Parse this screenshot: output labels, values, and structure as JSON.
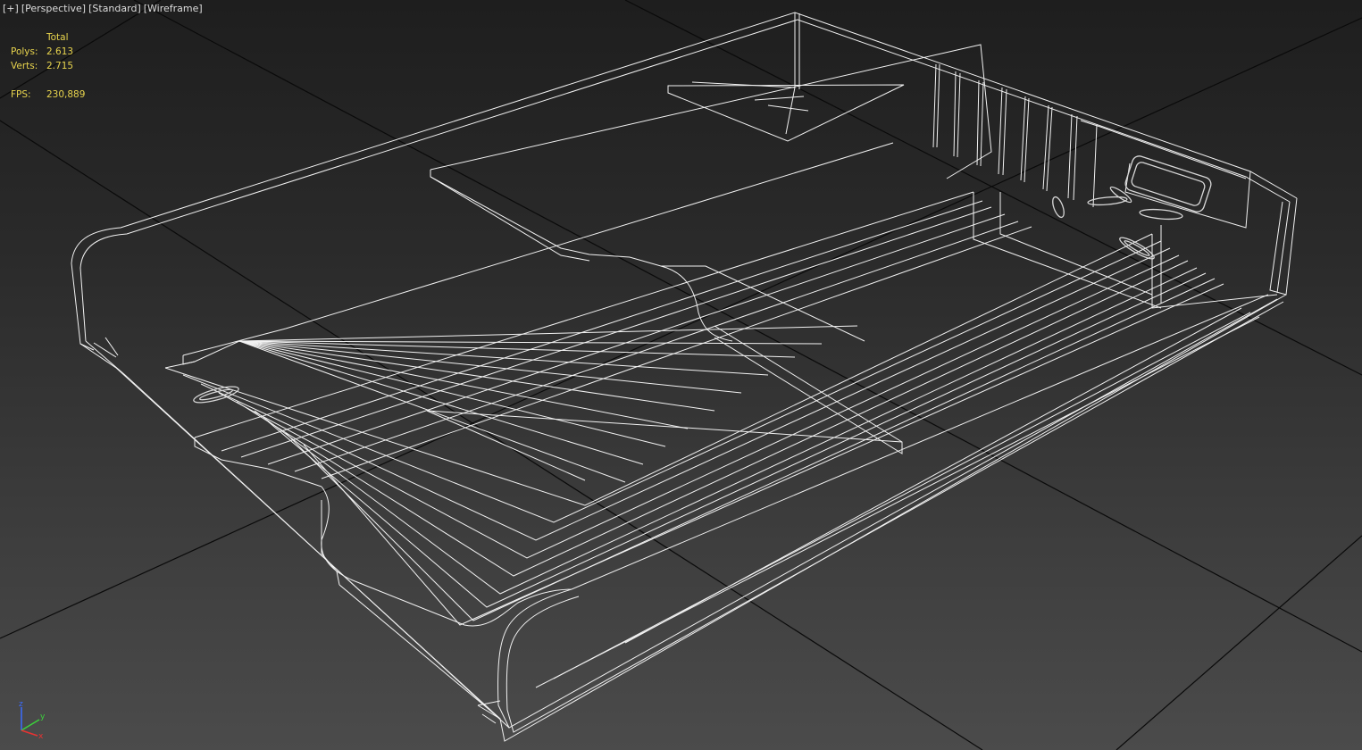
{
  "viewport": {
    "labels": [
      "[+]",
      "[Perspective]",
      "[Standard]",
      "[Wireframe]"
    ]
  },
  "stats": {
    "header": "Total",
    "polys_label": "Polys:",
    "polys_value": "2.613",
    "verts_label": "Verts:",
    "verts_value": "2.715",
    "fps_label": "FPS:",
    "fps_value": "230,889"
  },
  "gizmo": {
    "z_label": "z",
    "y_label": "y",
    "x_label": "x",
    "z_color": "#3b6cff",
    "y_color": "#3bd23b",
    "x_color": "#e83232"
  },
  "colors": {
    "wireframe": "#f2f2f2",
    "stats_text": "#e8d44d",
    "grid": "#0a0a0a"
  }
}
